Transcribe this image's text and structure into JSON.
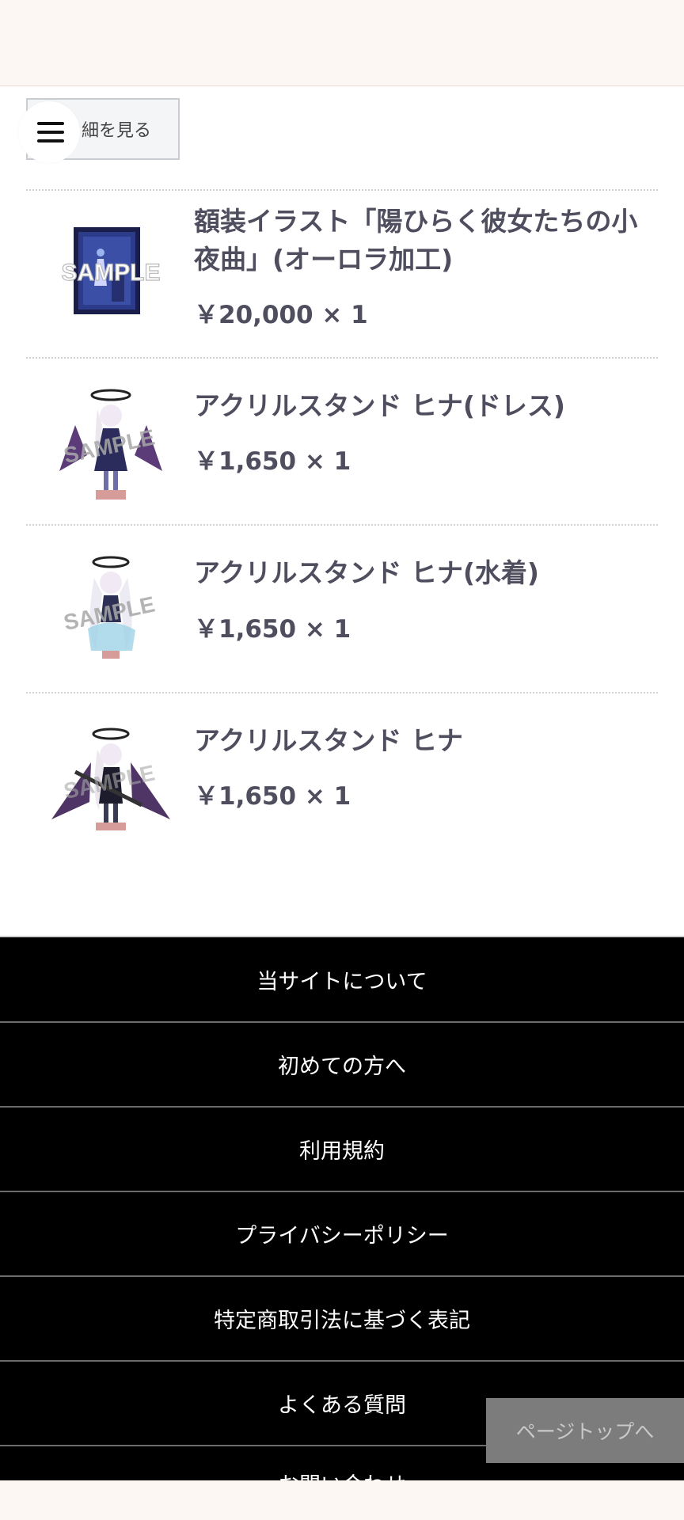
{
  "colors": {
    "header_bg": "#fdf7f4",
    "text": "#4f4e5f",
    "footer_bg": "#000000",
    "page_top_bg": "#7c7c7c"
  },
  "details_button": {
    "label": "細を見る"
  },
  "menu_button": {
    "icon": "hamburger-menu-icon"
  },
  "items": [
    {
      "name_lines": [
        "額装イラスト「陽ひらく彼女たちの小",
        "夜曲」(オーロラ加工)"
      ],
      "price": "￥20,000 × 1",
      "thumb_label": "SAMPLE"
    },
    {
      "name_lines": [
        "アクリルスタンド ヒナ(ドレス)"
      ],
      "price": "￥1,650 × 1",
      "thumb_label": "SAMPLE"
    },
    {
      "name_lines": [
        "アクリルスタンド ヒナ(水着)"
      ],
      "price": "￥1,650 × 1",
      "thumb_label": "SAMPLE"
    },
    {
      "name_lines": [
        "アクリルスタンド ヒナ"
      ],
      "price": "￥1,650 × 1",
      "thumb_label": "SAMPLE"
    }
  ],
  "footer_links": [
    "当サイトについて",
    "初めての方へ",
    "利用規約",
    "プライバシーポリシー",
    "特定商取引法に基づく表記",
    "よくある質問",
    "お問い合わせ"
  ],
  "page_top": {
    "label": "ページトップへ"
  }
}
